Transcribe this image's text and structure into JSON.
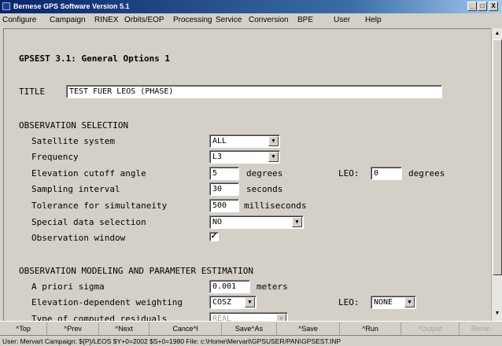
{
  "window": {
    "title": "Bernese GPS Software Version 5.1",
    "controls": [
      "_",
      "□",
      "X"
    ]
  },
  "menu": [
    "Configure",
    "Campaign",
    "RINEX",
    "Orbits/EOP",
    "Processing",
    "Service",
    "Conversion",
    "BPE",
    "User",
    "Help"
  ],
  "panel": {
    "heading": "GPSEST 3.1: General Options 1",
    "title_label": "TITLE",
    "title_value": "TEST FUER LEOS (PHASE)",
    "obs_section": "OBSERVATION SELECTION",
    "satellite_system": {
      "label": "Satellite system",
      "value": "ALL"
    },
    "frequency": {
      "label": "Frequency",
      "value": "L3"
    },
    "elevation_cutoff": {
      "label": "Elevation cutoff angle",
      "value": "5",
      "unit": "degrees",
      "leo_label": "LEO:",
      "leo_value": "0",
      "leo_unit": "degrees"
    },
    "sampling_interval": {
      "label": "Sampling interval",
      "value": "30",
      "unit": "seconds"
    },
    "tolerance": {
      "label": "Tolerance for simultaneity",
      "value": "500",
      "unit": "milliseconds"
    },
    "special_data": {
      "label": "Special data selection",
      "value": "NO"
    },
    "observation_window": {
      "label": "Observation window",
      "checked": "✓"
    },
    "model_section": "OBSERVATION MODELING AND PARAMETER ESTIMATION",
    "a_priori_sigma": {
      "label": "A priori sigma",
      "value": "0.001",
      "unit": "meters"
    },
    "elev_weighting": {
      "label": "Elevation-dependent weighting",
      "value": "COSZ",
      "leo_label": "LEO:",
      "leo_value": "NONE"
    },
    "computed_residuals": {
      "label": "Type of computed residuals",
      "value": "REAL"
    }
  },
  "bottom_buttons": [
    {
      "label": "^Top",
      "enabled": true
    },
    {
      "label": "^Prev",
      "enabled": true
    },
    {
      "label": "^Next",
      "enabled": true
    },
    {
      "label": "Cance^l",
      "enabled": true
    },
    {
      "label": "Save^As",
      "enabled": true
    },
    {
      "label": "^Save",
      "enabled": true
    },
    {
      "label": "^Run",
      "enabled": true
    },
    {
      "label": "^Output",
      "enabled": false
    },
    {
      "label": "Rerun",
      "enabled": false
    }
  ],
  "status": "User: Mervart  Campaign: ${P}/LEOS   $Y+0=2002  $S+0=1980   File: c:\\Home\\Mervart\\GPSUSER/PAN\\GPSEST.INP"
}
